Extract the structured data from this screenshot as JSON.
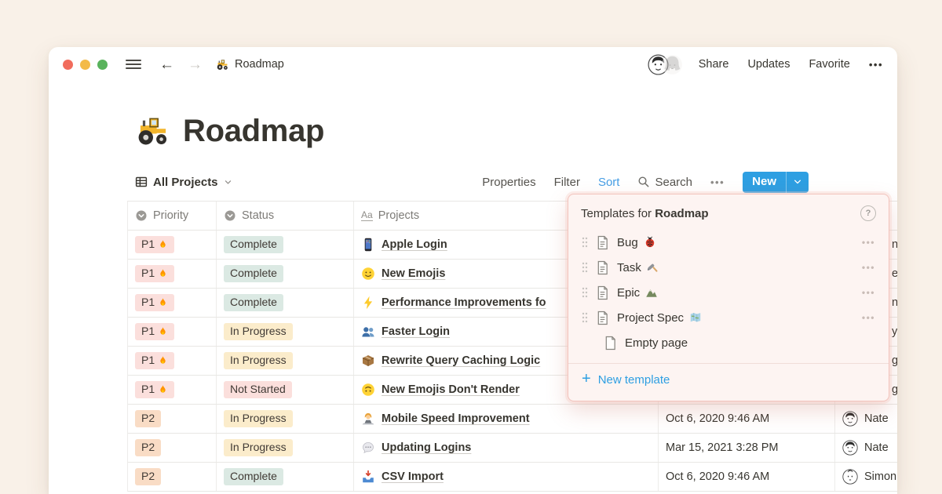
{
  "colors": {
    "page_background": "#f9f1e8",
    "accent_blue": "#2e9fe2",
    "link_blue": "#459de4",
    "popup_background": "#fdf4f2",
    "popup_border": "#f2c3bc",
    "tag_red": "#fbdfdc",
    "tag_orange": "#f9dcc5",
    "tag_green": "#dbe9e3",
    "tag_yellow": "#fbeccb"
  },
  "topbar": {
    "back": "←",
    "forward": "→",
    "doc_icon": "🚜",
    "doc_title": "Roadmap",
    "share": "Share",
    "updates": "Updates",
    "favorite": "Favorite",
    "more": "•••"
  },
  "page": {
    "icon": "🚜",
    "title": "Roadmap"
  },
  "toolbar": {
    "view_name": "All Projects",
    "properties": "Properties",
    "filter": "Filter",
    "sort": "Sort",
    "search": "Search",
    "more": "•••",
    "new_label": "New"
  },
  "table": {
    "headers": [
      {
        "icon": "select-property-icon",
        "label": "Priority"
      },
      {
        "icon": "select-property-icon",
        "label": "Status"
      },
      {
        "icon": "title-property-icon",
        "icon_text": "Aa",
        "label": "Projects"
      }
    ],
    "rows": [
      {
        "priority": "P1",
        "priority_emoji": "🔥",
        "status": "Complete",
        "project_emoji": "📱",
        "project": "Apple Login",
        "date": "",
        "person": "",
        "person_fragment": "n Z"
      },
      {
        "priority": "P1",
        "priority_emoji": "🔥",
        "status": "Complete",
        "project_emoji": "🙂",
        "project": "New Emojis",
        "date": "",
        "person": "",
        "person_fragment": "e"
      },
      {
        "priority": "P1",
        "priority_emoji": "🔥",
        "status": "Complete",
        "project_emoji": "⚡",
        "project": "Performance Improvements fo",
        "date": "",
        "person": "",
        "person_fragment": "ni"
      },
      {
        "priority": "P1",
        "priority_emoji": "🔥",
        "status": "In Progress",
        "project_emoji": "👥",
        "project": "Faster Login",
        "date": "",
        "person": "",
        "person_fragment": "y"
      },
      {
        "priority": "P1",
        "priority_emoji": "🔥",
        "status": "In Progress",
        "project_emoji": "📦",
        "project": "Rewrite Query Caching Logic",
        "date": "",
        "person": "",
        "person_fragment": "ge"
      },
      {
        "priority": "P1",
        "priority_emoji": "🔥",
        "status": "Not Started",
        "project_emoji": "🙃",
        "project": "New Emojis Don't Render",
        "date": "",
        "person": "",
        "person_fragment": "ge"
      },
      {
        "priority": "P2",
        "priority_emoji": "",
        "status": "In Progress",
        "project_emoji": "👩‍💻",
        "project": "Mobile Speed Improvement",
        "date": "Oct 6, 2020 9:46 AM",
        "person": "Nate",
        "person_fragment": ""
      },
      {
        "priority": "P2",
        "priority_emoji": "",
        "status": "In Progress",
        "project_emoji": "💬",
        "project": "Updating Logins",
        "date": "Mar 15, 2021 3:28 PM",
        "person": "Nate",
        "person_fragment": ""
      },
      {
        "priority": "P2",
        "priority_emoji": "",
        "status": "Complete",
        "project_emoji": "📥",
        "project": "CSV Import",
        "date": "Oct 6, 2020 9:46 AM",
        "person": "Simon",
        "person_fragment": ""
      }
    ]
  },
  "templates_popup": {
    "title_prefix": "Templates for",
    "title_name": "Roadmap",
    "help": "?",
    "items": [
      {
        "label": "Bug",
        "emoji": "🐞",
        "more": "•••"
      },
      {
        "label": "Task",
        "emoji": "🔨",
        "more": "•••"
      },
      {
        "label": "Epic",
        "emoji": "⛰️",
        "more": "•••"
      },
      {
        "label": "Project Spec",
        "emoji": "🗺️",
        "more": "•••"
      },
      {
        "label": "Empty page",
        "emoji": "",
        "more": ""
      }
    ],
    "new_template": "New template"
  }
}
